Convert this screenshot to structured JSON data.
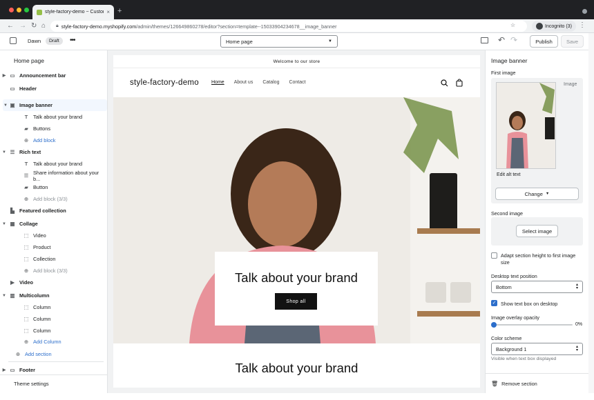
{
  "browser": {
    "tab_title": "style-factory-demo ~ Customi...",
    "url_host": "style-factory-demo.myshopify.com",
    "url_path": "/admin/themes/126649860278/editor?section=template--15033904234678__image_banner",
    "profile": "Incognito (3)"
  },
  "topbar": {
    "theme_name": "Dawn",
    "theme_badge": "Draft",
    "page_selector": "Home page",
    "publish": "Publish",
    "save": "Save"
  },
  "sidebar": {
    "title": "Home page",
    "items": [
      {
        "label": "Announcement bar"
      },
      {
        "label": "Header"
      },
      {
        "label": "Image banner"
      },
      {
        "label": "Talk about your brand"
      },
      {
        "label": "Buttons"
      },
      {
        "label": "Add block"
      },
      {
        "label": "Rich text"
      },
      {
        "label": "Talk about your brand"
      },
      {
        "label": "Share information about your b..."
      },
      {
        "label": "Button"
      },
      {
        "label": "Add block (3/3)"
      },
      {
        "label": "Featured collection"
      },
      {
        "label": "Collage"
      },
      {
        "label": "Video"
      },
      {
        "label": "Product"
      },
      {
        "label": "Collection"
      },
      {
        "label": "Add block (3/3)"
      },
      {
        "label": "Video"
      },
      {
        "label": "Multicolumn"
      },
      {
        "label": "Column"
      },
      {
        "label": "Column"
      },
      {
        "label": "Column"
      },
      {
        "label": "Add Column"
      },
      {
        "label": "Add section"
      },
      {
        "label": "Footer"
      }
    ],
    "theme_settings": "Theme settings"
  },
  "store": {
    "announcement": "Welcome to our store",
    "logo": "style-factory-demo",
    "nav": [
      "Home",
      "About us",
      "Catalog",
      "Contact"
    ],
    "hero_heading": "Talk about your brand",
    "hero_button": "Shop all",
    "rich_text_heading": "Talk about your brand"
  },
  "settings": {
    "title": "Image banner",
    "first_image_label": "First image",
    "image_tag": "Image",
    "edit_alt_text": "Edit alt text",
    "change_button": "Change",
    "second_image_label": "Second image",
    "select_image_button": "Select image",
    "adapt_height_label": "Adapt section height to first image size",
    "adapt_height_checked": false,
    "desktop_text_position_label": "Desktop text position",
    "desktop_text_position_value": "Bottom",
    "show_text_box_label": "Show text box on desktop",
    "show_text_box_checked": true,
    "overlay_opacity_label": "Image overlay opacity",
    "overlay_opacity_value": "0%",
    "overlay_opacity_fraction": 0,
    "color_scheme_label": "Color scheme",
    "color_scheme_value": "Background 1",
    "color_scheme_help": "Visible when text box displayed",
    "remove_section": "Remove section"
  },
  "colors": {
    "accent": "#2c6ecb",
    "selected_bg": "#f2f7fe",
    "hero_button_bg": "#121212"
  }
}
